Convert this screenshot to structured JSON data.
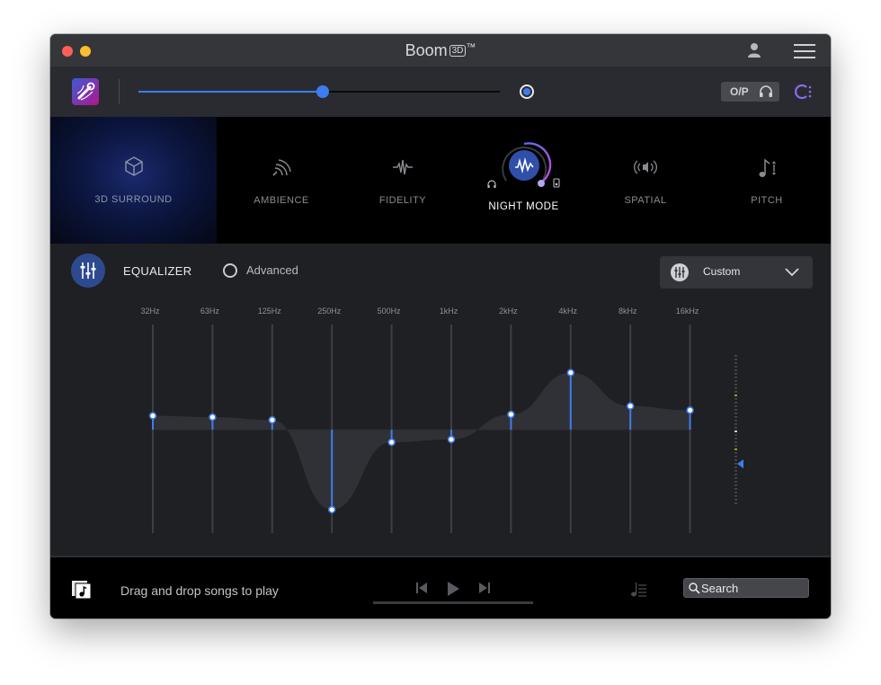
{
  "window": {
    "title": "Boom",
    "title_badge": "3D",
    "title_tm": "™"
  },
  "toolbar": {
    "volume_percent": 51,
    "output_label": "O/P"
  },
  "modes": [
    {
      "label": "3D SURROUND",
      "icon": "cube-icon",
      "active": false,
      "highlighted": true
    },
    {
      "label": "AMBIENCE",
      "icon": "ambience-waves-icon",
      "active": false
    },
    {
      "label": "FIDELITY",
      "icon": "waveform-icon",
      "active": false
    },
    {
      "label": "NIGHT MODE",
      "icon": "night-mode-waveform-icon",
      "active": true
    },
    {
      "label": "SPATIAL",
      "icon": "spatial-speaker-icon",
      "active": false
    },
    {
      "label": "PITCH",
      "icon": "pitch-note-icon",
      "active": false
    }
  ],
  "equalizer": {
    "title": "EQUALIZER",
    "advanced_label": "Advanced",
    "advanced_checked": false,
    "preset_label": "Custom",
    "bands": [
      {
        "freq": "32Hz",
        "gain_db": 2.0
      },
      {
        "freq": "63Hz",
        "gain_db": 1.8
      },
      {
        "freq": "125Hz",
        "gain_db": 1.4
      },
      {
        "freq": "250Hz",
        "gain_db": -11.5
      },
      {
        "freq": "500Hz",
        "gain_db": -1.8
      },
      {
        "freq": "1kHz",
        "gain_db": -1.4
      },
      {
        "freq": "2kHz",
        "gain_db": 2.2
      },
      {
        "freq": "4kHz",
        "gain_db": 8.2
      },
      {
        "freq": "8kHz",
        "gain_db": 3.4
      },
      {
        "freq": "16kHz",
        "gain_db": 2.8
      }
    ],
    "gain_range_db": [
      -15,
      15
    ],
    "accent_color": "#3d7cf0"
  },
  "player": {
    "drop_text": "Drag and drop songs to play",
    "search_placeholder": "Search"
  }
}
